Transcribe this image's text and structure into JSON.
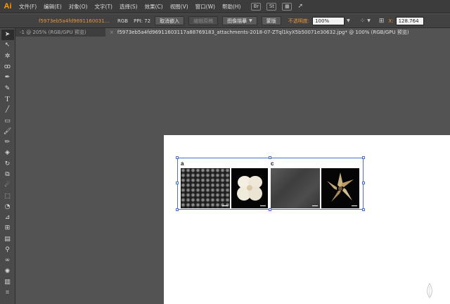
{
  "app": {
    "logo": "Ai"
  },
  "menu": [
    "文件(F)",
    "编辑(E)",
    "对象(O)",
    "文字(T)",
    "选择(S)",
    "效果(C)",
    "视图(V)",
    "窗口(W)",
    "帮助(H)"
  ],
  "menu_icons": {
    "br": "Br",
    "st": "St"
  },
  "control_bar": {
    "filename": "f5973eb5a4fd9691160031...",
    "color_mode": "RGB",
    "ppi": "PPI: 72",
    "buttons": {
      "unembed": "取消嵌入",
      "edit_original": "编辑原稿",
      "image_trace": "图像描摹",
      "mask": "蒙版"
    },
    "opacity_label": "不透明度:",
    "opacity_value": "100%",
    "x_label": "X:",
    "x_value": "128.764"
  },
  "tabs": [
    {
      "label": "-1 @ 205% (RGB/GPU 预览)"
    },
    {
      "label": "f5973eb5a4fd96911603117a88769183_attachments-2018-07-ZTql1kyX5b50071e30632.jpg* @ 100% (RGB/GPU 预览)",
      "close": "×"
    }
  ],
  "tools": [
    "selection-tool",
    "direct-selection-tool",
    "magic-wand-tool",
    "lasso-tool",
    "pen-tool",
    "curvature-tool",
    "type-tool",
    "line-tool",
    "rectangle-tool",
    "paintbrush-tool",
    "pencil-tool",
    "eraser-tool",
    "rotate-tool",
    "scale-tool",
    "warp-tool",
    "free-transform-tool",
    "shape-builder-tool",
    "perspective-grid-tool",
    "mesh-tool",
    "gradient-tool",
    "eyedropper-tool",
    "blend-tool",
    "symbol-sprayer-tool",
    "column-graph-tool",
    "artboard-tool"
  ],
  "figure": {
    "label_a": "a",
    "label_c": "c"
  }
}
